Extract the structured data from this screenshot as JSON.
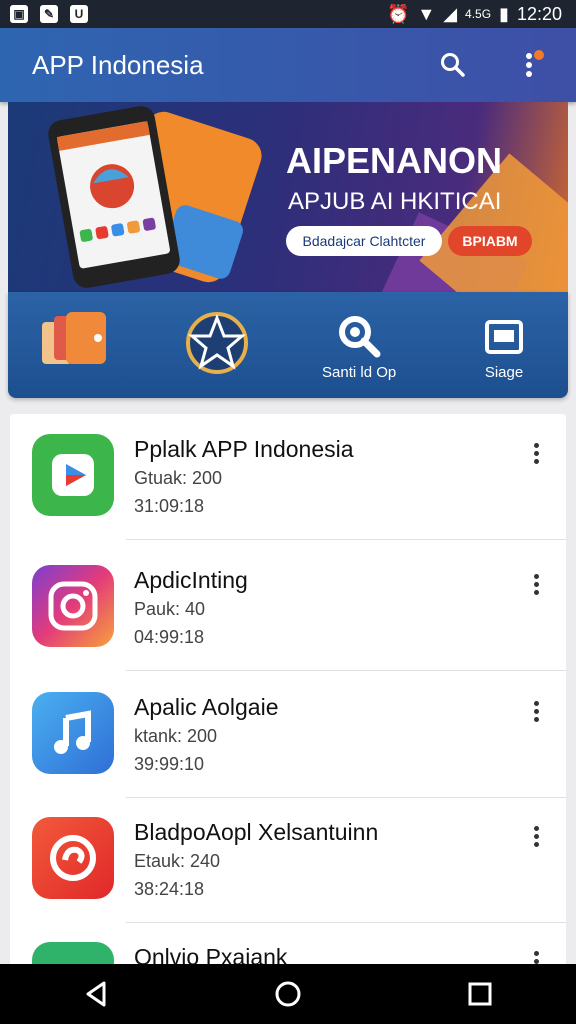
{
  "status_bar": {
    "left_icons": [
      "gallery-icon",
      "edit-icon",
      "shield-icon"
    ],
    "signal_text": "4.5G",
    "time": "12:20"
  },
  "app_bar": {
    "title": "APP Indonesia",
    "search_icon": "search-icon",
    "menu_icon": "more-vert-icon"
  },
  "banner": {
    "headline": "AIPENANON",
    "subhead": "APJUB AI HKITICAI",
    "button_primary": "Bdadajcar Clahtcter",
    "button_secondary": "BPIABM"
  },
  "quick_actions": [
    {
      "icon": "apps-folder-icon",
      "label": ""
    },
    {
      "icon": "star-compass-icon",
      "label": ""
    },
    {
      "icon": "search-gear-icon",
      "label": "Santi ld Op"
    },
    {
      "icon": "screen-icon",
      "label": "Siage"
    }
  ],
  "apps": [
    {
      "name": "Pplalk APP Indonesia",
      "line1": "Gtuak: 200",
      "line2": "31:09:18",
      "icon": "play-icon",
      "color": "#3cb54a"
    },
    {
      "name": "ApdicInting",
      "line1": "Pauk: 40",
      "line2": "04:99:18",
      "icon": "camera-icon",
      "color": "#c13584"
    },
    {
      "name": "Apalic Aolgaie",
      "line1": "ktank: 200",
      "line2": "39:99:10",
      "icon": "music-note-icon",
      "color": "#3a8ee6"
    },
    {
      "name": "BladpoAopl Xelsantuinn",
      "line1": "Etauk: 240",
      "line2": "38:24:18",
      "icon": "swirl-icon",
      "color": "#e63b2e"
    },
    {
      "name": "Onlvio Pxaiank",
      "line1": "",
      "line2": "",
      "icon": "play-icon",
      "color": "#2fb36a"
    }
  ]
}
